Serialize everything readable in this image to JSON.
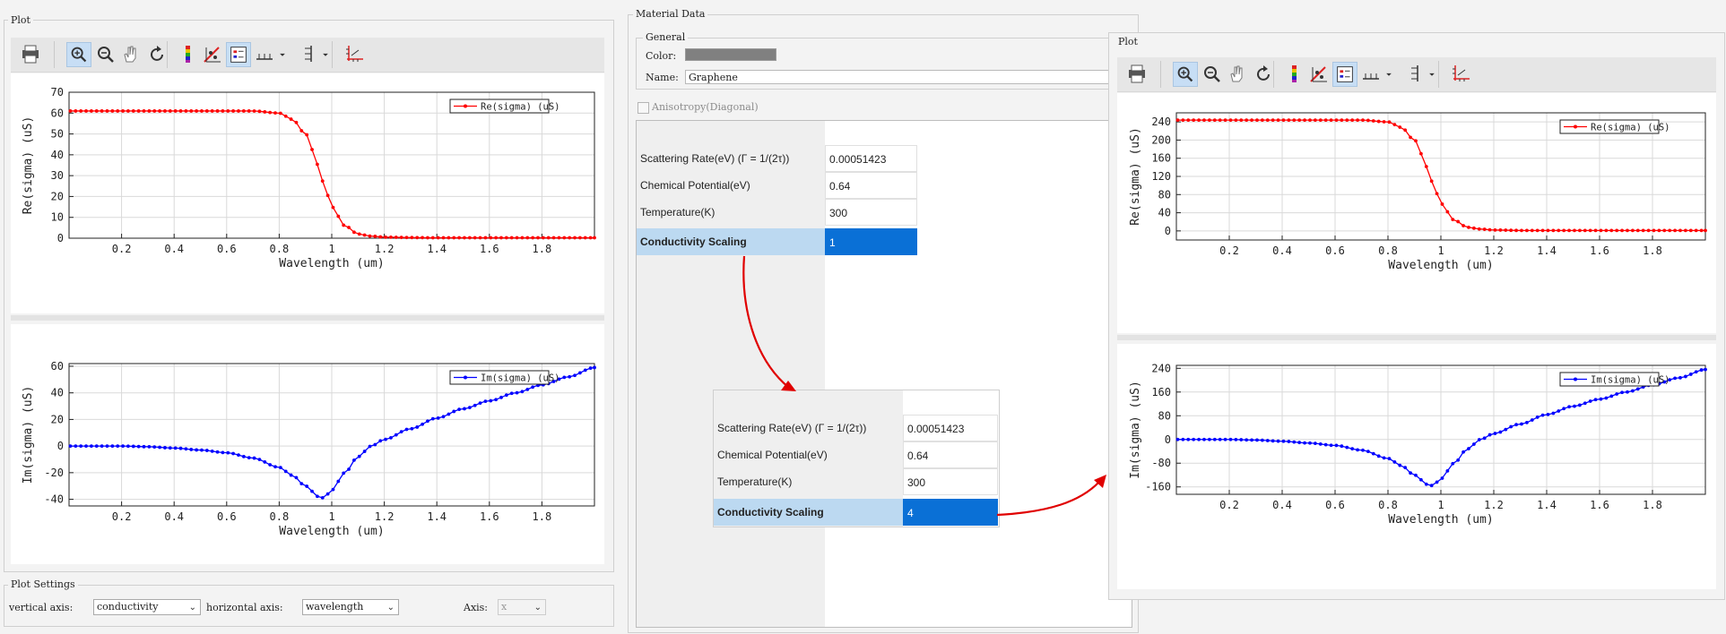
{
  "panels": {
    "left_plot": {
      "title": "Plot"
    },
    "plot_settings": {
      "title": "Plot Settings",
      "vertical_axis_label": "vertical axis:",
      "vertical_axis_value": "conductivity",
      "horizontal_axis_label": "horizontal axis:",
      "horizontal_axis_value": "wavelength",
      "axis_label": "Axis:",
      "axis_value": "x"
    },
    "material": {
      "title": "Material Data",
      "general_title": "General",
      "color_label": "Color:",
      "color_value": "#808080",
      "name_label": "Name:",
      "name_value": "Graphene",
      "anisotropy_label": "Anisotropy(Diagonal)"
    },
    "right_plot": {
      "title": "Plot"
    }
  },
  "toolbar_icons": [
    "printer-icon",
    "zoom-in-icon",
    "zoom-out-icon",
    "pan-hand-icon",
    "reset-view-icon",
    "color-map-icon",
    "clear-markers-icon",
    "legend-toggle-icon",
    "x-ticks-icon",
    "x-ticks-dropdown-icon",
    "y-ticks-icon",
    "y-ticks-dropdown-icon",
    "axes-settings-icon"
  ],
  "table_original": [
    {
      "label": "Scattering Rate(eV) (Γ = 1/(2τ))",
      "value": "0.00051423"
    },
    {
      "label": "Chemical Potential(eV)",
      "value": "0.64"
    },
    {
      "label": "Temperature(K)",
      "value": "300"
    },
    {
      "label": "Conductivity Scaling",
      "value": "1"
    }
  ],
  "table_scaled": [
    {
      "label": "Scattering Rate(eV) (Γ = 1/(2τ))",
      "value": "0.00051423"
    },
    {
      "label": "Chemical Potential(eV)",
      "value": "0.64"
    },
    {
      "label": "Temperature(K)",
      "value": "300"
    },
    {
      "label": "Conductivity Scaling",
      "value": "4"
    }
  ],
  "colors": {
    "re_series": "#ff0000",
    "im_series": "#0000ff",
    "arrow": "#e00000",
    "selection": "#0a70d6"
  },
  "chart_data": [
    {
      "type": "line",
      "title": "",
      "xlabel": "Wavelength (um)",
      "ylabel": "Re(sigma) (uS)",
      "xlim": [
        0.0,
        2.0
      ],
      "ylim": [
        0,
        70
      ],
      "x_ticks": [
        "0.2",
        "0.4",
        "0.6",
        "0.8",
        "1",
        "1.2",
        "1.4",
        "1.6",
        "1.8"
      ],
      "y_ticks": [
        "0",
        "10",
        "20",
        "30",
        "40",
        "50",
        "60",
        "70"
      ],
      "legend_position": "top-right",
      "grid": true,
      "series": [
        {
          "name": "Re(sigma) (uS)",
          "kind": "re",
          "x": [
            0.01,
            0.1,
            0.2,
            0.3,
            0.4,
            0.5,
            0.6,
            0.7,
            0.8,
            0.85,
            0.9,
            0.95,
            0.97,
            1.0,
            1.05,
            1.1,
            1.15,
            1.2,
            1.3,
            1.4,
            1.6,
            1.8,
            2.0
          ],
          "values": [
            61,
            61,
            61,
            61,
            61,
            61,
            61,
            61,
            60,
            57,
            50,
            35,
            26,
            15,
            6,
            2,
            1,
            0.5,
            0.3,
            0.2,
            0.2,
            0.2,
            0.2
          ]
        }
      ]
    },
    {
      "type": "line",
      "title": "",
      "xlabel": "Wavelength (um)",
      "ylabel": "Im(sigma) (uS)",
      "xlim": [
        0.0,
        2.0
      ],
      "ylim": [
        -45,
        62
      ],
      "x_ticks": [
        "0.2",
        "0.4",
        "0.6",
        "0.8",
        "1",
        "1.2",
        "1.4",
        "1.6",
        "1.8"
      ],
      "y_ticks": [
        "-40",
        "-20",
        "0",
        "20",
        "40",
        "60"
      ],
      "legend_position": "top-right",
      "grid": true,
      "series": [
        {
          "name": "Im(sigma) (uS)",
          "kind": "im",
          "x": [
            0.01,
            0.1,
            0.2,
            0.3,
            0.4,
            0.5,
            0.6,
            0.7,
            0.8,
            0.85,
            0.9,
            0.95,
            0.97,
            1.0,
            1.05,
            1.1,
            1.15,
            1.2,
            1.3,
            1.4,
            1.5,
            1.6,
            1.7,
            1.8,
            1.9,
            2.0
          ],
          "values": [
            0,
            0,
            0,
            -0.5,
            -1.5,
            -3,
            -5,
            -9,
            -16,
            -22,
            -30,
            -38,
            -39,
            -33,
            -20,
            -8,
            0,
            5,
            13,
            21,
            28,
            34,
            40,
            46,
            52,
            59
          ]
        }
      ]
    },
    {
      "type": "line",
      "title": "",
      "xlabel": "Wavelength (um)",
      "ylabel": "Re(sigma) (uS)",
      "xlim": [
        0.0,
        2.0
      ],
      "ylim": [
        -20,
        260
      ],
      "x_ticks": [
        "0.2",
        "0.4",
        "0.6",
        "0.8",
        "1",
        "1.2",
        "1.4",
        "1.6",
        "1.8"
      ],
      "y_ticks": [
        "0",
        "40",
        "80",
        "120",
        "160",
        "200",
        "240"
      ],
      "legend_position": "top-right",
      "grid": true,
      "series": [
        {
          "name": "Re(sigma) (uS)",
          "kind": "re",
          "x": [
            0.01,
            0.1,
            0.2,
            0.3,
            0.4,
            0.5,
            0.6,
            0.7,
            0.8,
            0.85,
            0.9,
            0.95,
            0.97,
            1.0,
            1.05,
            1.1,
            1.15,
            1.2,
            1.3,
            1.4,
            1.6,
            1.8,
            2.0
          ],
          "values": [
            244,
            244,
            244,
            244,
            244,
            244,
            244,
            244,
            240,
            228,
            200,
            140,
            104,
            60,
            24,
            8,
            4,
            2,
            1,
            1,
            1,
            1,
            1
          ]
        }
      ]
    },
    {
      "type": "line",
      "title": "",
      "xlabel": "Wavelength (um)",
      "ylabel": "Im(sigma) (uS)",
      "xlim": [
        0.0,
        2.0
      ],
      "ylim": [
        -185,
        250
      ],
      "x_ticks": [
        "0.2",
        "0.4",
        "0.6",
        "0.8",
        "1",
        "1.2",
        "1.4",
        "1.6",
        "1.8"
      ],
      "y_ticks": [
        "-160",
        "-80",
        "0",
        "80",
        "160",
        "240"
      ],
      "legend_position": "top-right",
      "grid": true,
      "series": [
        {
          "name": "Im(sigma) (uS)",
          "kind": "im",
          "x": [
            0.01,
            0.1,
            0.2,
            0.3,
            0.4,
            0.5,
            0.6,
            0.7,
            0.8,
            0.85,
            0.9,
            0.95,
            0.97,
            1.0,
            1.05,
            1.1,
            1.15,
            1.2,
            1.3,
            1.4,
            1.5,
            1.6,
            1.7,
            1.8,
            1.9,
            2.0
          ],
          "values": [
            0,
            0,
            0,
            -2,
            -6,
            -12,
            -20,
            -36,
            -64,
            -88,
            -120,
            -152,
            -156,
            -132,
            -80,
            -32,
            0,
            20,
            52,
            84,
            112,
            136,
            160,
            184,
            208,
            236
          ]
        }
      ]
    }
  ]
}
